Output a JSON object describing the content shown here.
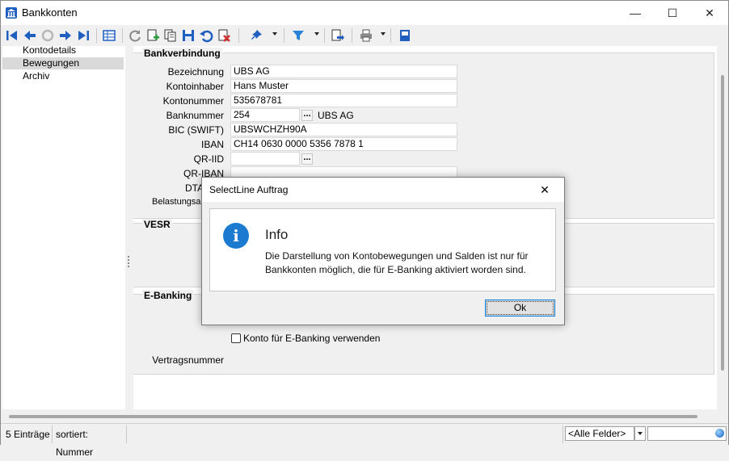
{
  "window": {
    "title": "Bankkonten",
    "minimize_glyph": "—",
    "maximize_glyph": "☐",
    "close_glyph": "✕"
  },
  "toolbar": {
    "icons": [
      "first-record-icon",
      "prev-record-icon",
      "disabled-icon",
      "next-record-icon",
      "last-record-icon",
      "table-view-icon",
      "refresh-icon",
      "new-record-icon",
      "copy-record-icon",
      "save-icon",
      "undo-icon",
      "delete-icon",
      "pin-icon",
      "filter-icon",
      "export-icon",
      "print-icon",
      "save-disk-icon"
    ],
    "colors": {
      "blue": "#1f5fbf",
      "green": "#2e9b3a",
      "red": "#d12f2f"
    }
  },
  "nav": {
    "items": [
      "Kontodetails",
      "Bewegungen",
      "Archiv"
    ],
    "selected_index": 1
  },
  "bankverbindung": {
    "title": "Bankverbindung",
    "labels": {
      "bezeichnung": "Bezeichnung",
      "kontoinhaber": "Kontoinhaber",
      "kontonummer": "Kontonummer",
      "banknummer": "Banknummer",
      "bic": "BIC (SWIFT)",
      "iban": "IBAN",
      "qr_iid": "QR-IID",
      "qr_iban": "QR-IBAN",
      "dta": "DTA/L",
      "belastung": "Belastungsar"
    },
    "values": {
      "bezeichnung": "UBS AG",
      "kontoinhaber": "Hans Muster",
      "kontonummer": "535678781",
      "banknummer": "254",
      "bank_name": "UBS AG",
      "bic": "UBSWCHZH90A",
      "iban": "CH14 0630 0000 5356 7878 1",
      "qr_iid": "",
      "qr_iban": ""
    },
    "dots_label": "..."
  },
  "vesr": {
    "title": "VESR"
  },
  "ebanking": {
    "title": "E-Banking",
    "checkbox_label": "Konto für E-Banking verwenden",
    "checked": false,
    "vertragsnummer_label": "Vertragsnummer"
  },
  "status": {
    "count": "5 Einträge",
    "sort": "sortiert: Nummer",
    "field_select": "<Alle Felder>"
  },
  "dialog": {
    "title": "SelectLine Auftrag",
    "close_glyph": "✕",
    "icon_glyph": "i",
    "heading": "Info",
    "message": "Die Darstellung von Kontobewegungen und Salden ist nur für Bankkonten möglich, die für E-Banking aktiviert worden sind.",
    "ok_label": "Ok"
  }
}
